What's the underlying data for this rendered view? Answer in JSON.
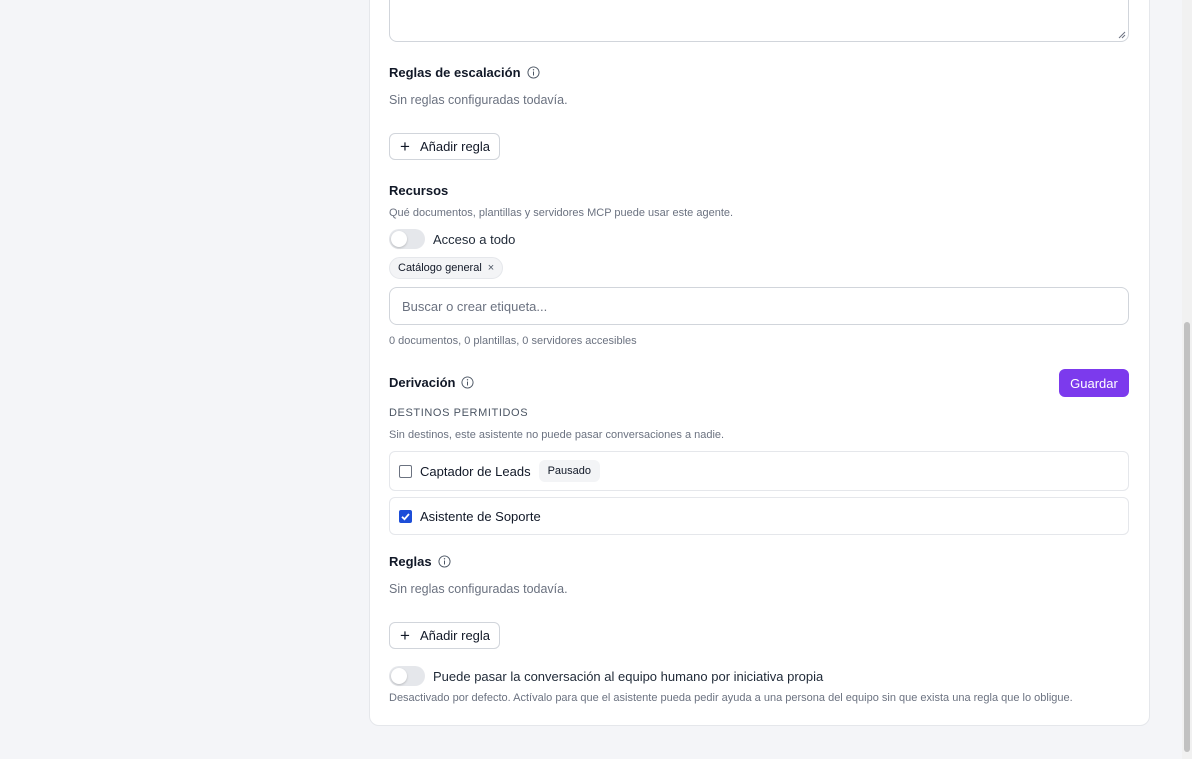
{
  "escalation": {
    "title": "Reglas de escalación",
    "empty": "Sin reglas configuradas todavía.",
    "add_button": "Añadir regla"
  },
  "resources": {
    "title": "Recursos",
    "description": "Qué documentos, plantillas y servidores MCP puede usar este agente.",
    "toggle_label": "Acceso a todo",
    "toggle_on": false,
    "chip_label": "Catálogo general",
    "chip_remove": "×",
    "search_placeholder": "Buscar o crear etiqueta...",
    "summary": "0 documentos, 0 plantillas, 0 servidores accesibles"
  },
  "derivation": {
    "title": "Derivación",
    "save_button": "Guardar",
    "destinations_heading": "DESTINOS PERMITIDOS",
    "destinations_note": "Sin destinos, este asistente no puede pasar conversaciones a nadie.",
    "destinations": [
      {
        "label": "Captador de Leads",
        "checked": false,
        "badge": "Pausado"
      },
      {
        "label": "Asistente de Soporte",
        "checked": true,
        "badge": ""
      }
    ],
    "rules_title": "Reglas",
    "rules_empty": "Sin reglas configuradas todavía.",
    "rules_add_button": "Añadir regla",
    "human_toggle_label": "Puede pasar la conversación al equipo humano por iniciativa propia",
    "human_toggle_on": false,
    "human_toggle_note": "Desactivado por defecto. Actívalo para que el asistente pueda pedir ayuda a una persona del equipo sin que exista una regla que lo obligue."
  },
  "colors": {
    "accent": "#7c3aed",
    "checkbox_checked": "#1d4ed8",
    "page_bg": "#f4f5f8"
  }
}
